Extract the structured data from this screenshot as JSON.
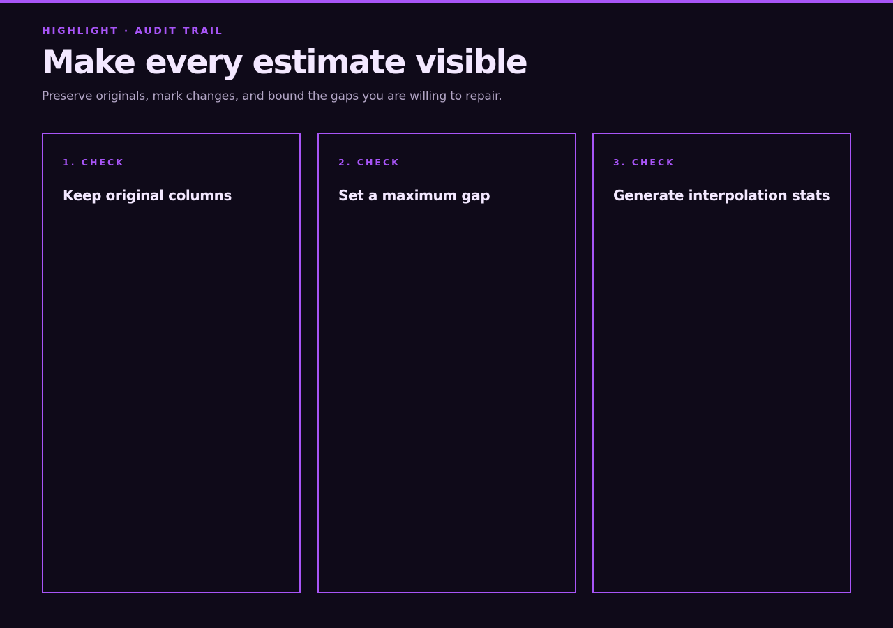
{
  "header": {
    "eyebrow": "HIGHLIGHT · AUDIT TRAIL",
    "title": "Make every estimate visible",
    "subtitle": "Preserve originals, mark changes, and bound the gaps you are willing to repair."
  },
  "cards": [
    {
      "step": "1. CHECK",
      "title": "Keep original columns"
    },
    {
      "step": "2. CHECK",
      "title": "Set a maximum gap"
    },
    {
      "step": "3. CHECK",
      "title": "Generate interpolation stats"
    }
  ],
  "colors": {
    "background": "#0f0a19",
    "accent": "#a855f7",
    "heading": "#f3e8ff",
    "muted": "#b3a6c6"
  }
}
